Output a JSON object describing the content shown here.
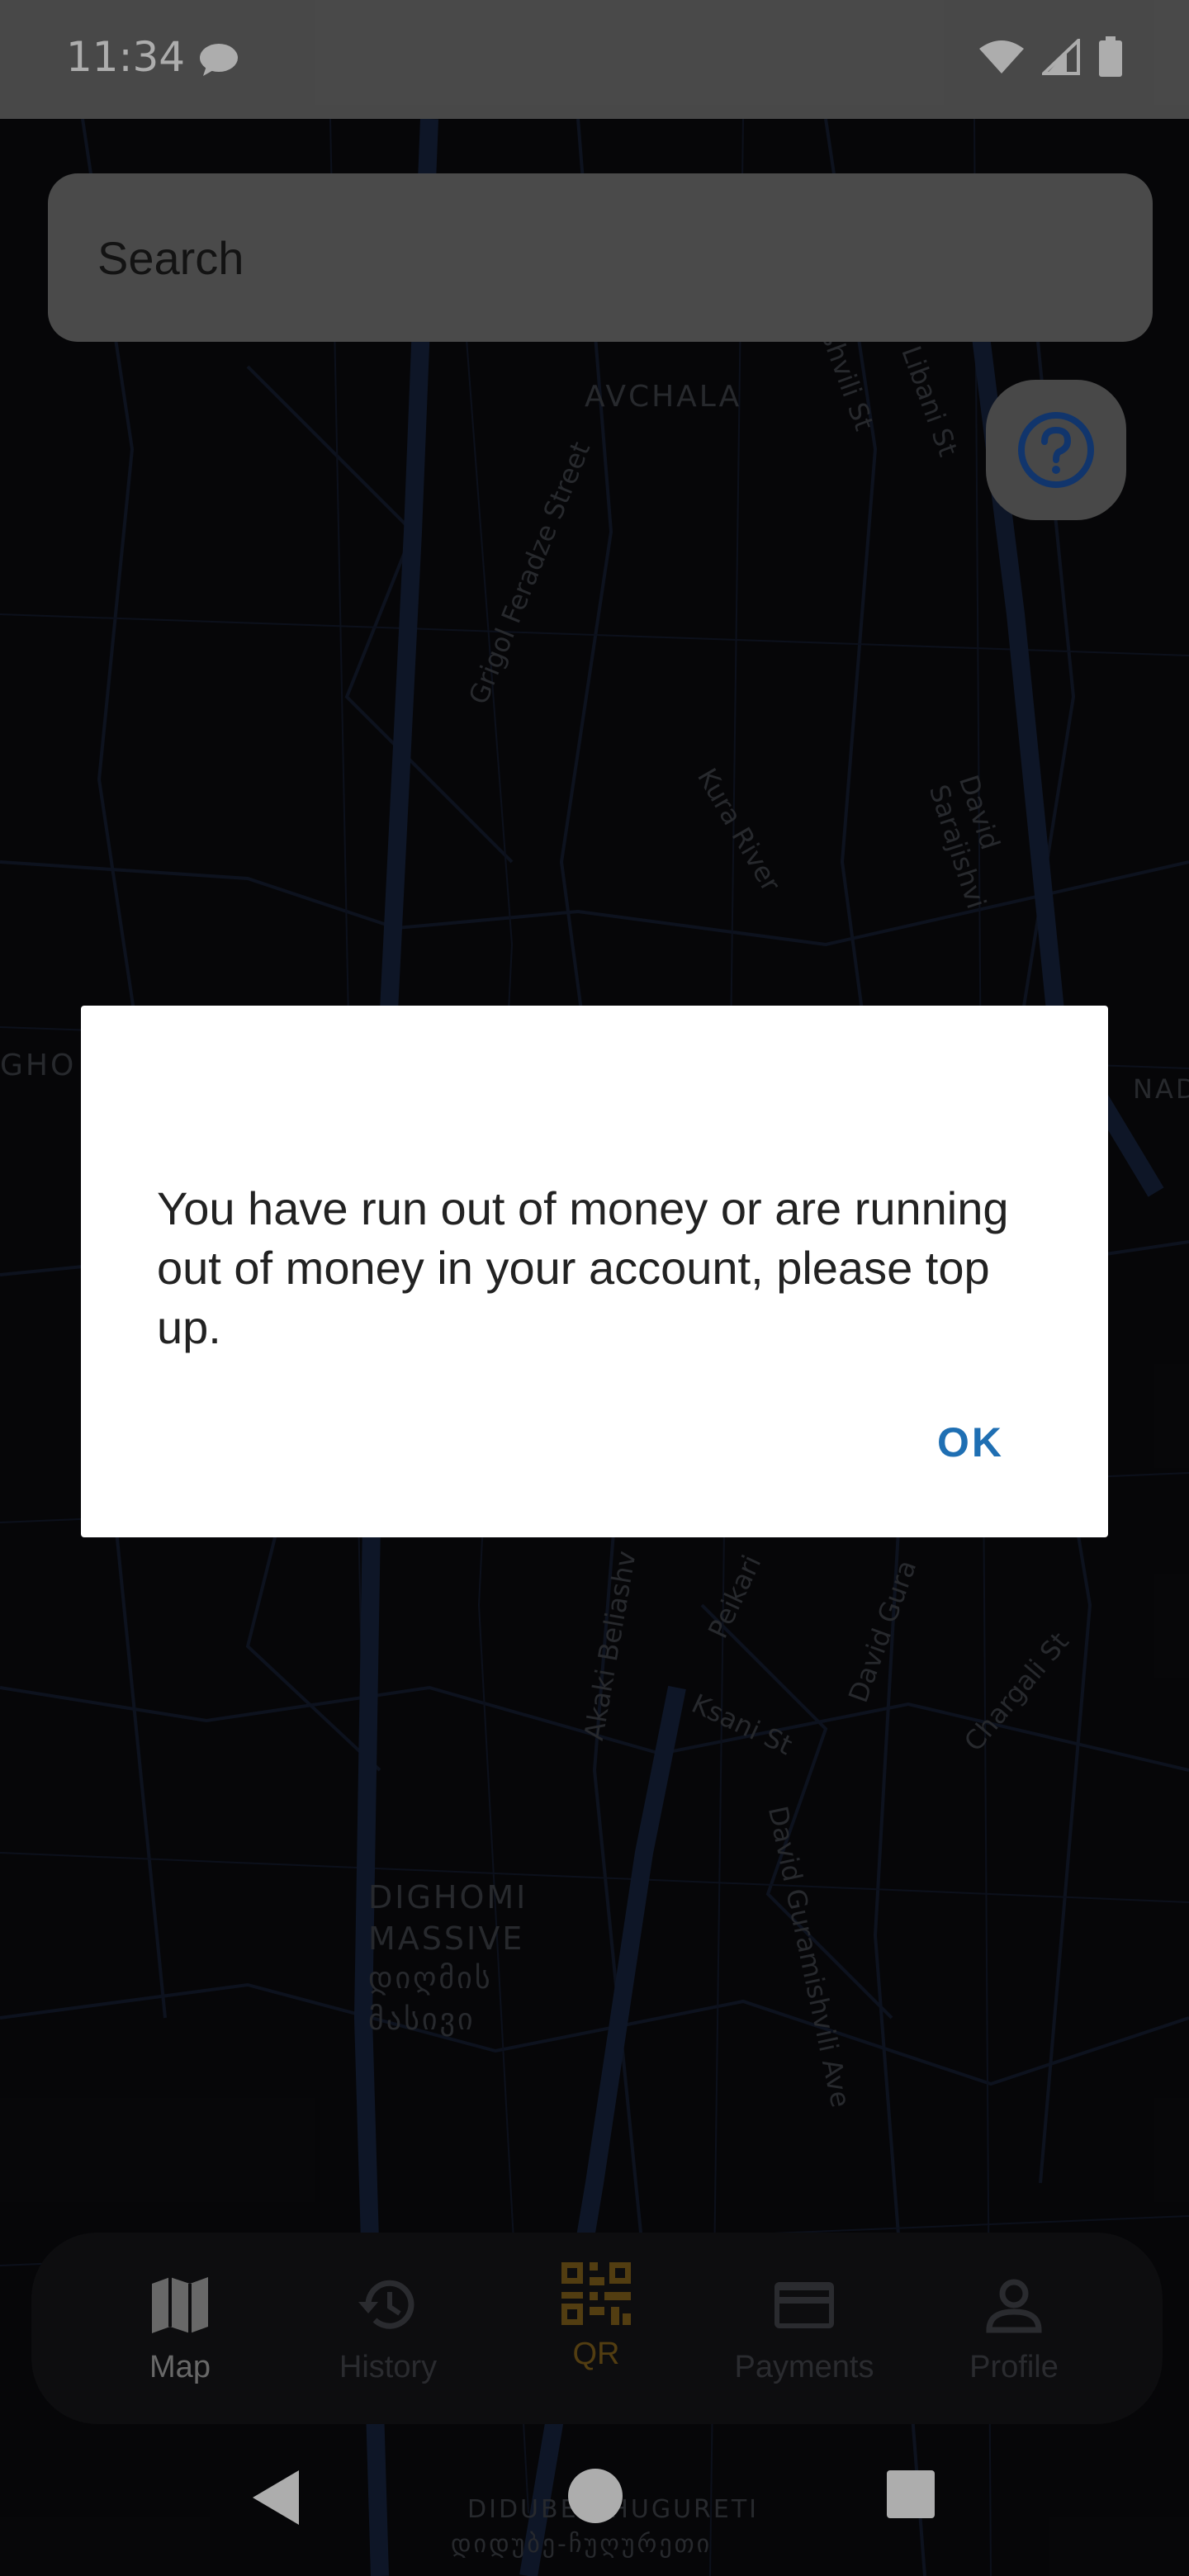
{
  "status_bar": {
    "time": "11:34"
  },
  "search": {
    "placeholder": "Search"
  },
  "map": {
    "labels": {
      "avchala": "AVCHALA",
      "grigol": "Grigol Feradze Street",
      "kura": "Kura River",
      "libani": "Libani St",
      "kashvili": "kashvili St",
      "david_sarajishvili": "David Sarajishvi",
      "gho": "GHO",
      "nad": "NAD",
      "dighomi_1": "DIGHOMI",
      "dighomi_2": "MASSIVE",
      "dighomi_3": "დიღმის",
      "dighomi_4": "მასივი",
      "ksani": "Ksani St",
      "akaki": "Akaki Beliashv",
      "peikari": "Peikari",
      "david_gura": "David Gura",
      "chargali": "Chargali St",
      "david_guramishvili": "David Guramishvili Ave",
      "didube": "DIDUBE-CHUGURETI",
      "didube_geo": "დიდუბე-ჩუღურეთი"
    }
  },
  "dialog": {
    "message": "You have run out of money or are running out of money in your account, please top up.",
    "ok_label": "OK"
  },
  "bottom_nav": {
    "items": [
      {
        "label": "Map",
        "icon": "map-icon"
      },
      {
        "label": "History",
        "icon": "history-icon"
      },
      {
        "label": "QR",
        "icon": "qr-icon"
      },
      {
        "label": "Payments",
        "icon": "card-icon"
      },
      {
        "label": "Profile",
        "icon": "person-icon"
      }
    ]
  },
  "colors": {
    "ok_accent": "#1f6fb3",
    "qr_accent": "#7a5a1a",
    "help_icon": "#1a4fa0"
  }
}
